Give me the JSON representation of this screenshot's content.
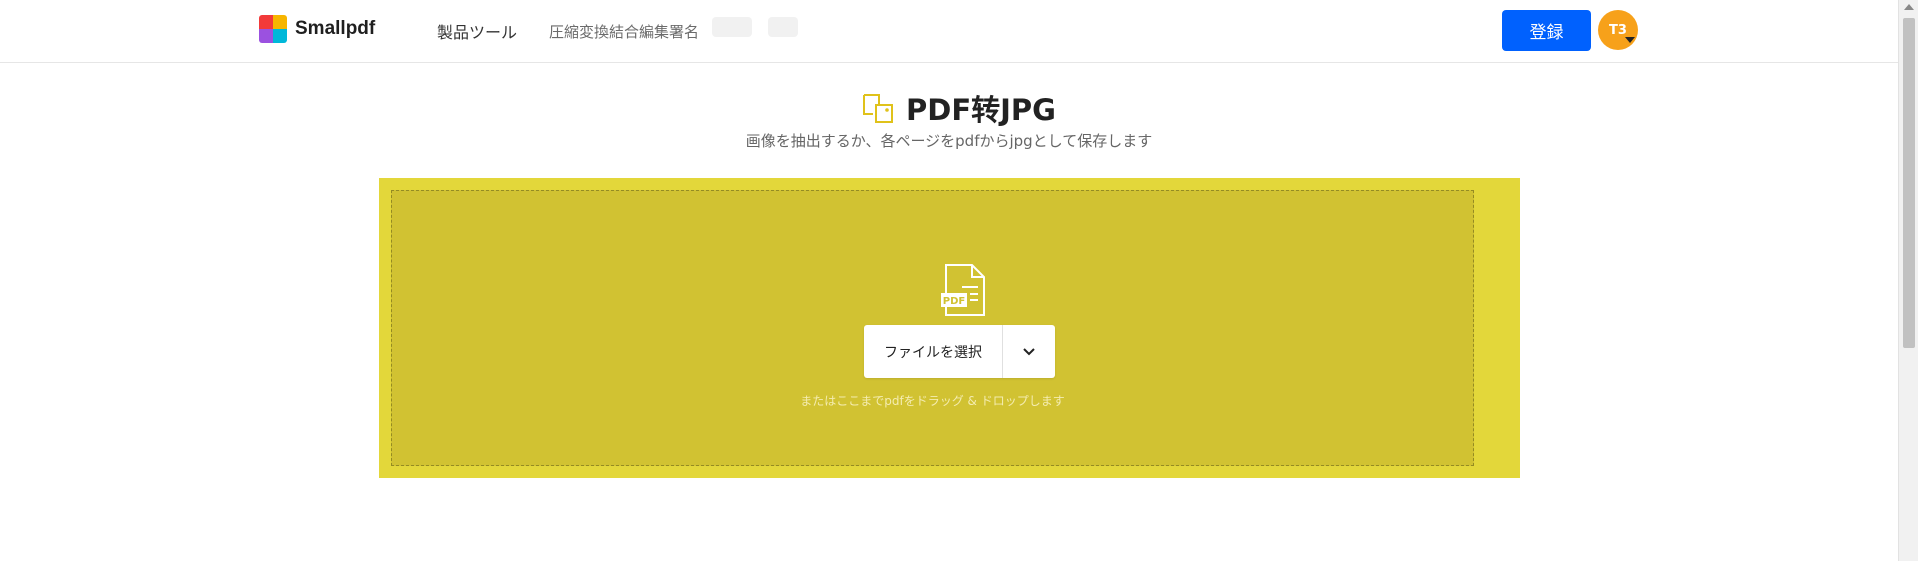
{
  "header": {
    "brand": "Smallpdf",
    "tools_label": "製品ツール",
    "nav_links": "圧縮変換結合編集署名",
    "login_label": "登録",
    "avatar_initials": "T3"
  },
  "main": {
    "title": "PDF转JPG",
    "subtitle": "画像を抽出するか、各ページをpdfからjpgとして保存します",
    "choose_file_label": "ファイルを選択",
    "drop_hint": "またはここまでpdfをドラッグ & ドロップします"
  },
  "colors": {
    "brand_blue": "#0061fe",
    "avatar_orange": "#f7a11a",
    "dropzone_outer": "#e3d73a",
    "dropzone_inner": "#d1c232",
    "title_icon": "#e0c21a"
  },
  "icons": {
    "logo": "smallpdf-logo-icon",
    "title": "pdf-to-jpg-icon",
    "file": "pdf-file-icon",
    "dropdown": "chevron-down-icon"
  }
}
